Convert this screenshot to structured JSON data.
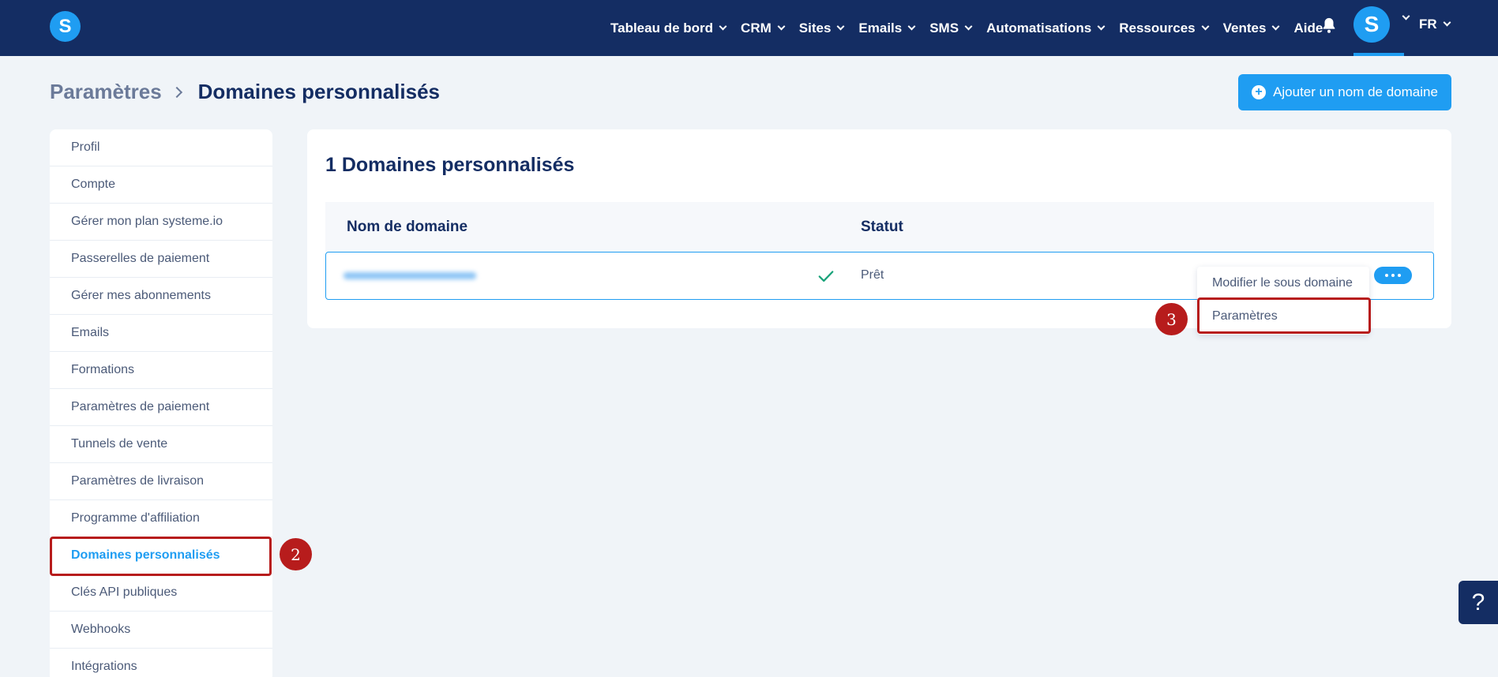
{
  "nav": {
    "logo_letter": "S",
    "items": [
      {
        "label": "Tableau de bord",
        "dropdown": true
      },
      {
        "label": "CRM",
        "dropdown": true
      },
      {
        "label": "Sites",
        "dropdown": true
      },
      {
        "label": "Emails",
        "dropdown": true
      },
      {
        "label": "SMS",
        "dropdown": true
      },
      {
        "label": "Automatisations",
        "dropdown": true
      },
      {
        "label": "Ressources",
        "dropdown": true
      },
      {
        "label": "Ventes",
        "dropdown": true
      },
      {
        "label": "Aide",
        "dropdown": false
      }
    ],
    "bell_icon": "bell-icon",
    "avatar_letter": "S",
    "language": "FR"
  },
  "breadcrumb": {
    "parent": "Paramètres",
    "current": "Domaines personnalisés"
  },
  "add_button": {
    "label": "Ajouter un nom de domaine",
    "icon": "plus-circle-icon"
  },
  "sidebar": {
    "items": [
      {
        "label": "Profil",
        "active": false
      },
      {
        "label": "Compte",
        "active": false
      },
      {
        "label": "Gérer mon plan systeme.io",
        "active": false
      },
      {
        "label": "Passerelles de paiement",
        "active": false
      },
      {
        "label": "Gérer mes abonnements",
        "active": false
      },
      {
        "label": "Emails",
        "active": false
      },
      {
        "label": "Formations",
        "active": false
      },
      {
        "label": "Paramètres de paiement",
        "active": false
      },
      {
        "label": "Tunnels de vente",
        "active": false
      },
      {
        "label": "Paramètres de livraison",
        "active": false
      },
      {
        "label": "Programme d'affiliation",
        "active": false
      },
      {
        "label": "Domaines personnalisés",
        "active": true
      },
      {
        "label": "Clés API publiques",
        "active": false
      },
      {
        "label": "Webhooks",
        "active": false
      },
      {
        "label": "Intégrations",
        "active": false
      }
    ]
  },
  "main": {
    "title": "1 Domaines personnalisés",
    "columns": [
      "Nom de domaine",
      "Statut"
    ],
    "rows": [
      {
        "domain": "",
        "status": "Prêt",
        "status_icon": "check-icon"
      }
    ]
  },
  "dropdown": {
    "items": [
      "Modifier le sous domaine",
      "Paramètres"
    ]
  },
  "annotations": {
    "step_2": "2",
    "step_3": "3",
    "highlight_color": "#b71c1c"
  },
  "help_button": "?",
  "colors": {
    "nav_bg": "#142d63",
    "accent": "#1f9df2",
    "page_bg": "#f0f4f8",
    "success": "#1aa37a"
  }
}
